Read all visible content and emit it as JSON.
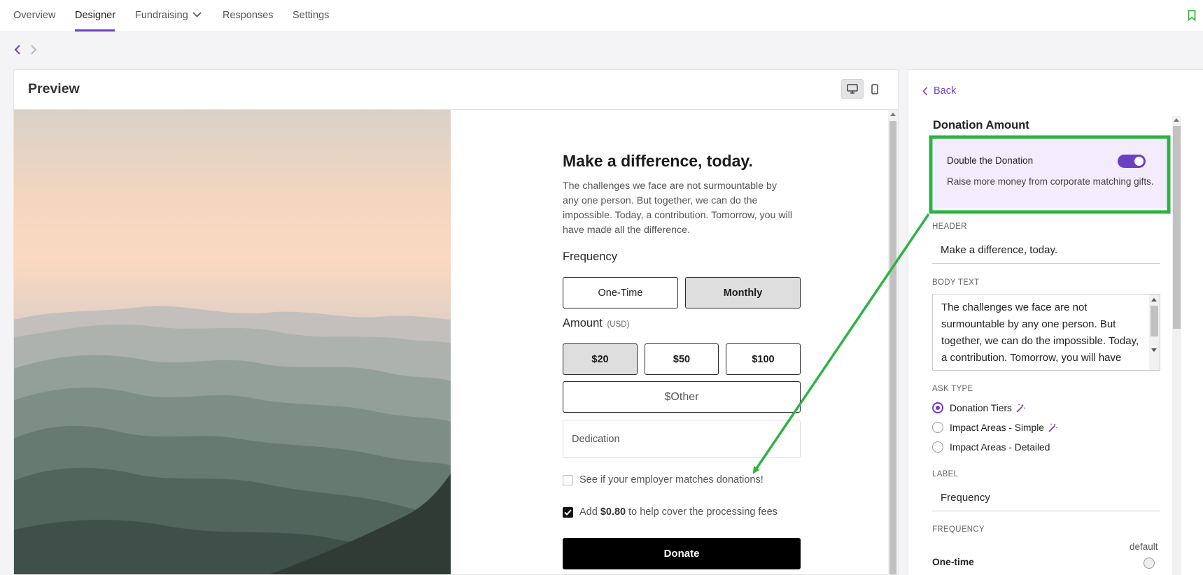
{
  "nav": {
    "tabs": [
      {
        "label": "Overview"
      },
      {
        "label": "Designer",
        "active": true
      },
      {
        "label": "Fundraising",
        "has_dropdown": true
      },
      {
        "label": "Responses"
      },
      {
        "label": "Settings"
      }
    ],
    "bookmark_icon": "bookmark-icon"
  },
  "preview": {
    "title": "Preview",
    "device_modes": [
      "desktop-icon",
      "mobile-icon"
    ],
    "selected_device": "desktop",
    "form": {
      "heading": "Make a difference, today.",
      "body": "The challenges we face are not surmountable by any one person. But together, we can do the impossible. Today, a contribution. Tomorrow, you will have made all the difference.",
      "frequency_label": "Frequency",
      "frequency_options": [
        "One-Time",
        "Monthly"
      ],
      "frequency_selected": "Monthly",
      "amount_label": "Amount",
      "amount_currency": "(USD)",
      "amount_options": [
        "$20",
        "$50",
        "$100"
      ],
      "amount_selected": "$20",
      "other_placeholder": "$Other",
      "dedication_placeholder": "Dedication",
      "employer_match_text": "See if your employer matches donations!",
      "employer_match_checked": false,
      "fee_prefix": "Add",
      "fee_amount": "$0.80",
      "fee_suffix": "to help cover the processing fees",
      "fee_checked": true,
      "donate_label": "Donate"
    }
  },
  "sidebar": {
    "back_label": "Back",
    "section_title": "Donation Amount",
    "double_the_donation": {
      "title": "Double the Donation",
      "description": "Raise more money from corporate matching gifts.",
      "enabled": true
    },
    "header_label": "HEADER",
    "header_value": "Make a difference, today.",
    "body_text_label": "BODY TEXT",
    "body_text_value": "The challenges we face are not surmountable by any one person. But together, we can do the impossible. Today, a contribution. Tomorrow, you will have made all the difference.",
    "ask_type_label": "ASK TYPE",
    "ask_types": [
      {
        "label": "Donation Tiers",
        "checked": true,
        "icon": "magic-wand-icon"
      },
      {
        "label": "Impact Areas - Simple",
        "checked": false,
        "icon": "magic-wand-icon"
      },
      {
        "label": "Impact Areas - Detailed",
        "checked": false
      }
    ],
    "label_label": "LABEL",
    "label_value": "Frequency",
    "frequency_label": "FREQUENCY",
    "default_label": "default",
    "frequency_item": "One-time"
  },
  "colors": {
    "accent": "#6c3fc7",
    "highlight_box": "#f3ecfd",
    "annotation": "#2db343"
  }
}
